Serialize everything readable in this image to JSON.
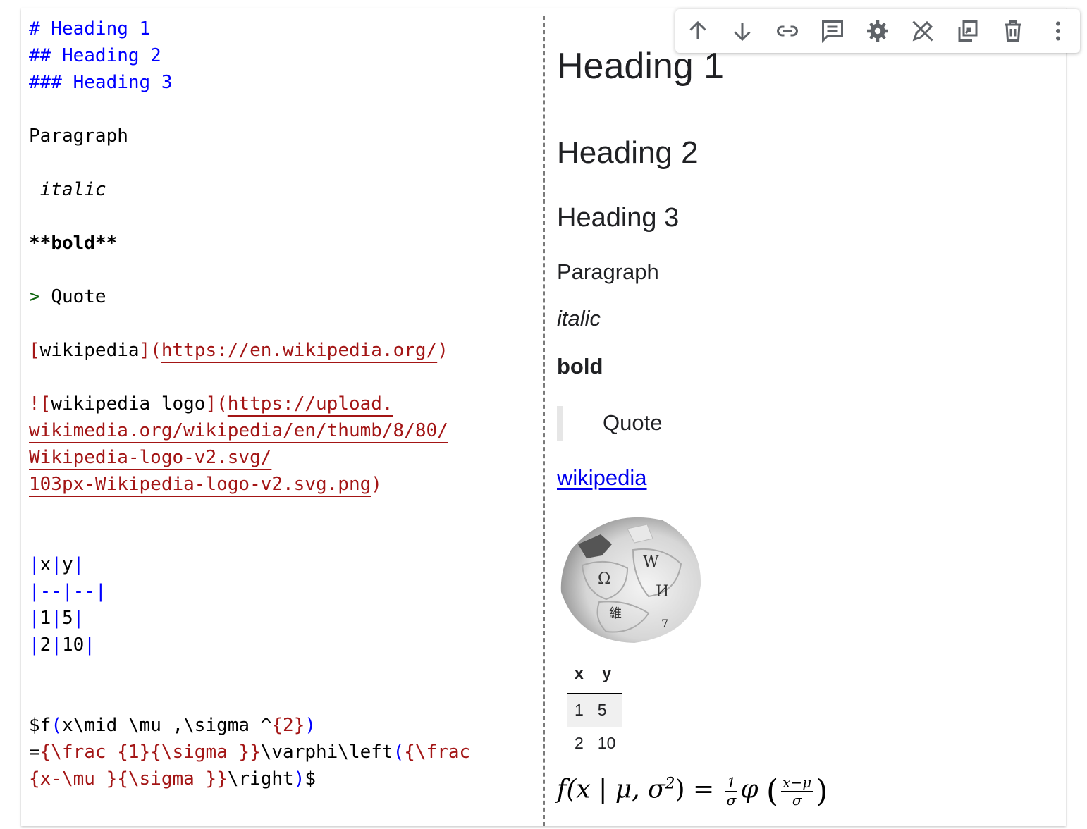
{
  "editor": {
    "line1": "# Heading 1",
    "line2": "## Heading 2",
    "line3": "### Heading 3",
    "paragraph": "Paragraph",
    "italic_open": "_",
    "italic_word": "italic",
    "italic_close": "_",
    "bold_marker_open": "**",
    "bold_word": "bold",
    "bold_marker_close": "**",
    "quote_marker": ">",
    "quote_text": "Quote",
    "link_open": "[",
    "link_text": "wikipedia",
    "link_close": "](",
    "link_url": "https://en.wikipedia.org/",
    "link_end": ")",
    "img_bang": "![",
    "img_alt": "wikipedia logo",
    "img_close": "](",
    "img_url_1": "https://upload.",
    "img_url_2": "wikimedia.org/wikipedia/en/thumb/8/80/",
    "img_url_3": "Wikipedia-logo-v2.svg/",
    "img_url_4": "103px-Wikipedia-logo-v2.svg.png",
    "img_end": ")",
    "table_row_1": [
      "x",
      "y"
    ],
    "table_sep": "--",
    "table_row_3": [
      "1",
      "5"
    ],
    "table_row_4": [
      "2",
      "10"
    ],
    "math_l1_a": "$f",
    "math_l1_b": "(",
    "math_l1_c": "x\\mid \\mu ,\\sigma ^",
    "math_l1_d": "{2}",
    "math_l1_e": ")",
    "math_l2_a": "=",
    "math_l2_b": "{\\frac {1}{\\sigma }}",
    "math_l2_c": "\\varphi\\left",
    "math_l2_d": "(",
    "math_l2_e": "{\\frac",
    "math_l3_a": "{x-\\mu }{\\sigma }}",
    "math_l3_b": "\\right",
    "math_l3_c": ")",
    "math_l3_d": "$"
  },
  "preview": {
    "heading1": "Heading 1",
    "heading2": "Heading 2",
    "heading3": "Heading 3",
    "paragraph": "Paragraph",
    "italic": "italic",
    "bold": "bold",
    "quote": "Quote",
    "link": "wikipedia",
    "image_alt": "wikipedia logo",
    "table": {
      "headers": [
        "x",
        "y"
      ],
      "rows": [
        [
          "1",
          "5"
        ],
        [
          "2",
          "10"
        ]
      ]
    },
    "math": {
      "lhs": "f(x | μ, σ",
      "exp": "2",
      "rhs_eq": ") = ",
      "frac1_num": "1",
      "frac1_den": "σ",
      "phi": "φ",
      "frac2_num": "x−μ",
      "frac2_den": "σ"
    }
  },
  "toolbar": {
    "icons": [
      "arrow-up",
      "arrow-down",
      "link",
      "comment",
      "settings",
      "edit-off",
      "mirror-in-tab",
      "delete",
      "more-vert"
    ]
  }
}
